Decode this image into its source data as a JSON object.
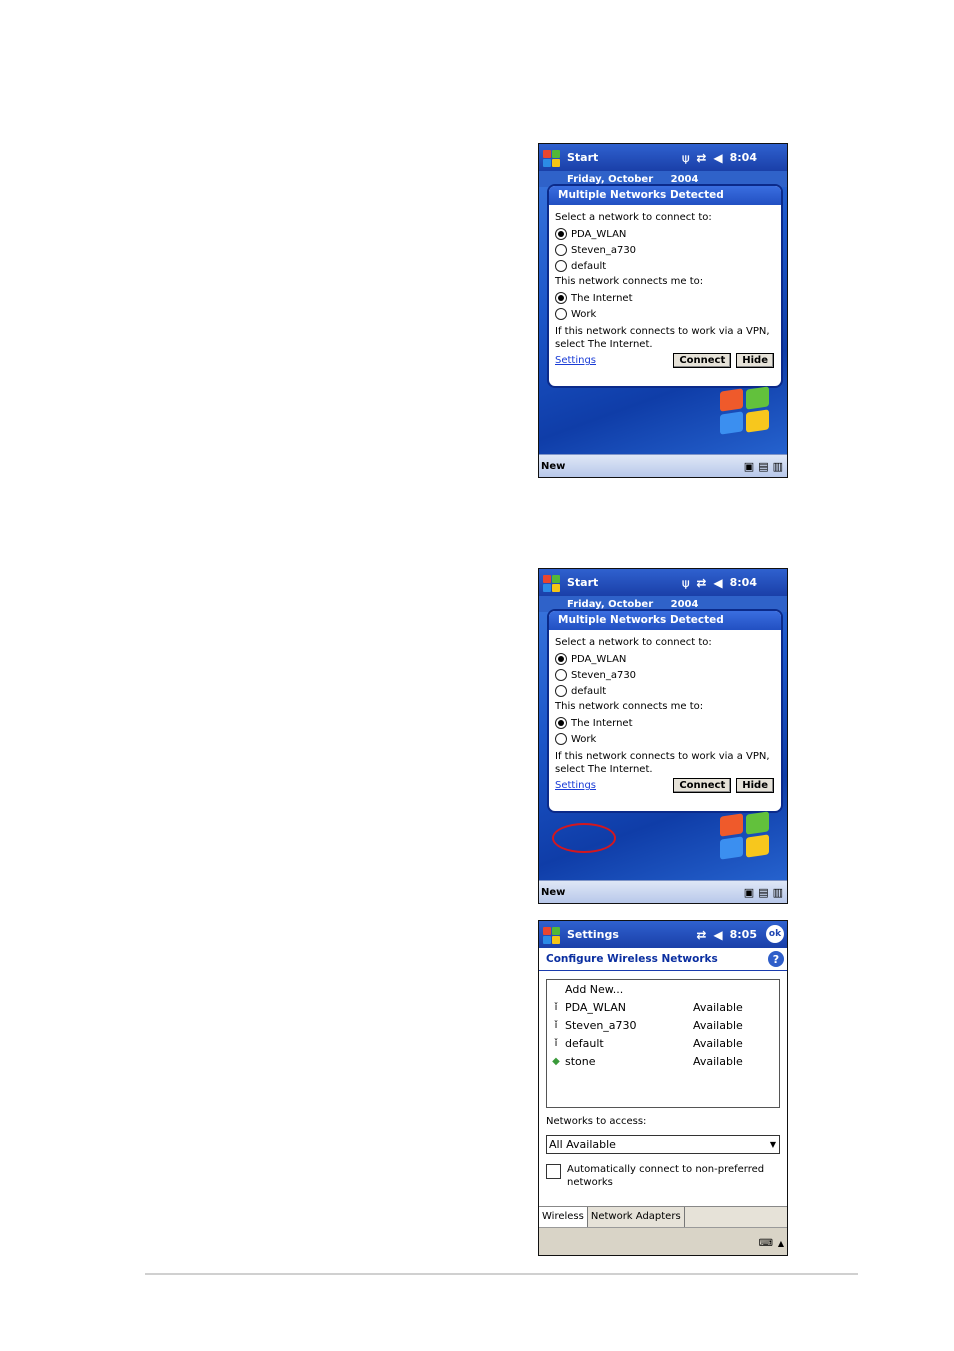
{
  "screen1": {
    "start_label": "Start",
    "time": "8:04",
    "today_date_left": "Friday, October",
    "today_date_right": "2004",
    "bubble_title": "Multiple Networks Detected",
    "select_prompt": "Select a network to connect to:",
    "networks": [
      "PDA_WLAN",
      "Steven_a730",
      "default"
    ],
    "connects_prompt": "This network connects me to:",
    "destinations": [
      "The Internet",
      "Work"
    ],
    "vpn_note": "If this network connects to work via a VPN, select The Internet.",
    "settings_link": "Settings",
    "connect_button": "Connect",
    "hide_button": "Hide",
    "new_label": "New"
  },
  "screen2": {
    "start_label": "Start",
    "time": "8:04",
    "today_date_left": "Friday, October",
    "today_date_right": "2004",
    "bubble_title": "Multiple Networks Detected",
    "select_prompt": "Select a network to connect to:",
    "networks": [
      "PDA_WLAN",
      "Steven_a730",
      "default"
    ],
    "connects_prompt": "This network connects me to:",
    "destinations": [
      "The Internet",
      "Work"
    ],
    "vpn_note": "If this network connects to work via a VPN, select The Internet.",
    "settings_link": "Settings",
    "connect_button": "Connect",
    "hide_button": "Hide",
    "new_label": "New"
  },
  "screen3": {
    "title": "Settings",
    "time": "8:05",
    "ok_label": "ok",
    "header": "Configure Wireless Networks",
    "add_new": "Add New...",
    "networks": [
      {
        "name": "PDA_WLAN",
        "status": "Available",
        "icon": "antenna-icon"
      },
      {
        "name": "Steven_a730",
        "status": "Available",
        "icon": "antenna-icon"
      },
      {
        "name": "default",
        "status": "Available",
        "icon": "antenna-icon"
      },
      {
        "name": "stone",
        "status": "Available",
        "icon": "computer-network-icon"
      }
    ],
    "access_label": "Networks to access:",
    "access_value": "All Available",
    "auto_connect_label": "Automatically connect to non-preferred networks",
    "tabs": [
      "Wireless",
      "Network Adapters"
    ]
  },
  "colors": {
    "title_bar": "#1a3fa8",
    "link": "#1a3cd6",
    "highlight_circle": "#d4171e"
  }
}
